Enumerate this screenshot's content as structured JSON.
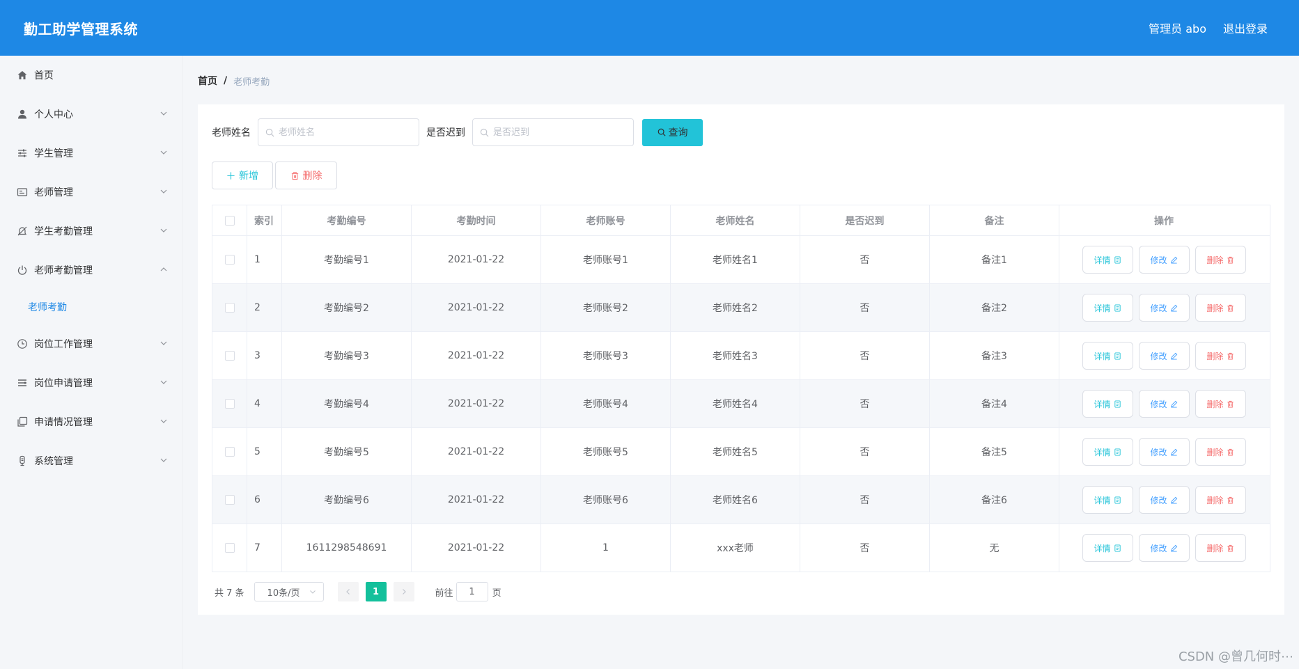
{
  "header": {
    "title": "勤工助学管理系统",
    "admin_label": "管理员 abo",
    "logout_label": "退出登录"
  },
  "sidebar": {
    "items": [
      {
        "label": "首页"
      },
      {
        "label": "个人中心"
      },
      {
        "label": "学生管理"
      },
      {
        "label": "老师管理"
      },
      {
        "label": "学生考勤管理"
      },
      {
        "label": "老师考勤管理"
      },
      {
        "label": "岗位工作管理"
      },
      {
        "label": "岗位申请管理"
      },
      {
        "label": "申请情况管理"
      },
      {
        "label": "系统管理"
      }
    ],
    "submenu_active": "老师考勤"
  },
  "breadcrumb": {
    "home": "首页",
    "separator": "/",
    "current": "老师考勤"
  },
  "search": {
    "name_label": "老师姓名",
    "name_placeholder": "老师姓名",
    "late_label": "是否迟到",
    "late_placeholder": "是否迟到",
    "query_label": "查询"
  },
  "actions": {
    "add_label": "新增",
    "delete_label": "删除"
  },
  "table": {
    "headers": [
      "索引",
      "考勤编号",
      "考勤时间",
      "老师账号",
      "老师姓名",
      "是否迟到",
      "备注",
      "操作"
    ],
    "op_labels": {
      "detail": "详情",
      "edit": "修改",
      "delete": "删除"
    },
    "rows": [
      {
        "index": "1",
        "code": "考勤编号1",
        "time": "2021-01-22",
        "account": "老师账号1",
        "name": "老师姓名1",
        "late": "否",
        "note": "备注1"
      },
      {
        "index": "2",
        "code": "考勤编号2",
        "time": "2021-01-22",
        "account": "老师账号2",
        "name": "老师姓名2",
        "late": "否",
        "note": "备注2"
      },
      {
        "index": "3",
        "code": "考勤编号3",
        "time": "2021-01-22",
        "account": "老师账号3",
        "name": "老师姓名3",
        "late": "否",
        "note": "备注3"
      },
      {
        "index": "4",
        "code": "考勤编号4",
        "time": "2021-01-22",
        "account": "老师账号4",
        "name": "老师姓名4",
        "late": "否",
        "note": "备注4"
      },
      {
        "index": "5",
        "code": "考勤编号5",
        "time": "2021-01-22",
        "account": "老师账号5",
        "name": "老师姓名5",
        "late": "否",
        "note": "备注5"
      },
      {
        "index": "6",
        "code": "考勤编号6",
        "time": "2021-01-22",
        "account": "老师账号6",
        "name": "老师姓名6",
        "late": "否",
        "note": "备注6"
      },
      {
        "index": "7",
        "code": "1611298548691",
        "time": "2021-01-22",
        "account": "1",
        "name": "xxx老师",
        "late": "否",
        "note": "无"
      }
    ]
  },
  "pagination": {
    "total_text": "共 7 条",
    "page_size": "10条/页",
    "current_page": "1",
    "goto_label": "前往",
    "jump_value": "1",
    "page_suffix": "页"
  },
  "watermark": "CSDN @曾几何时⋯",
  "colors": {
    "header": "#1e88e5",
    "query_button": "#22c3d8",
    "active_page": "#13c09b",
    "danger": "#f56c6c"
  }
}
